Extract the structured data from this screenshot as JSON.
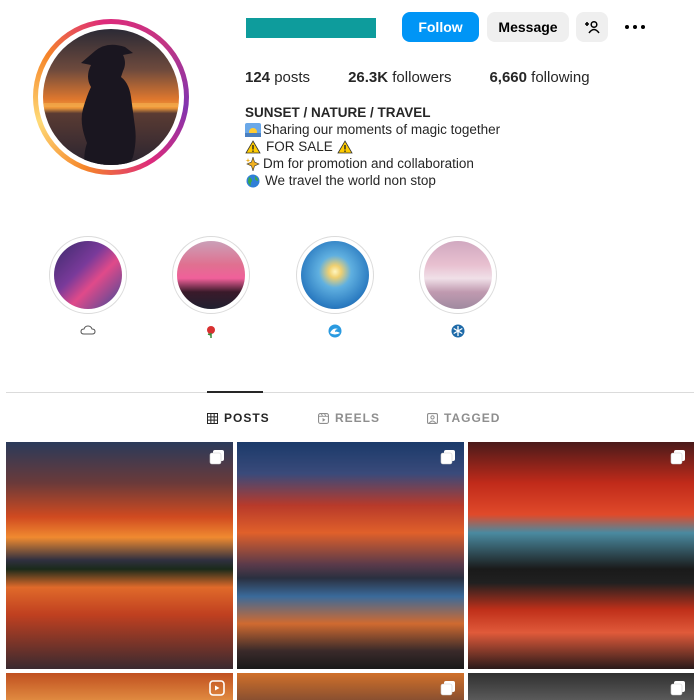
{
  "profile": {
    "follow_label": "Follow",
    "message_label": "Message",
    "stats": {
      "posts_count": "124",
      "posts_label": "posts",
      "followers_count": "26.3K",
      "followers_label": "followers",
      "following_count": "6,660",
      "following_label": "following"
    },
    "bio": {
      "name": "SUNSET / NATURE / TRAVEL",
      "line1": "Sharing our moments of magic together",
      "line2": "FOR SALE",
      "line3": "Dm for promotion and collaboration",
      "line4": "We travel the world non stop"
    }
  },
  "highlights": [
    {
      "icon": "cloud-icon"
    },
    {
      "icon": "rose-icon"
    },
    {
      "icon": "wave-icon"
    },
    {
      "icon": "snowflake-icon"
    }
  ],
  "tabs": [
    {
      "label": "POSTS",
      "icon": "grid-icon",
      "active": true
    },
    {
      "label": "REELS",
      "icon": "reels-icon",
      "active": false
    },
    {
      "label": "TAGGED",
      "icon": "tagged-icon",
      "active": false
    }
  ],
  "colors": {
    "accent": "#0095f6",
    "username_block": "#0e9c9c",
    "text": "#262626",
    "muted": "#8e8e8e"
  }
}
